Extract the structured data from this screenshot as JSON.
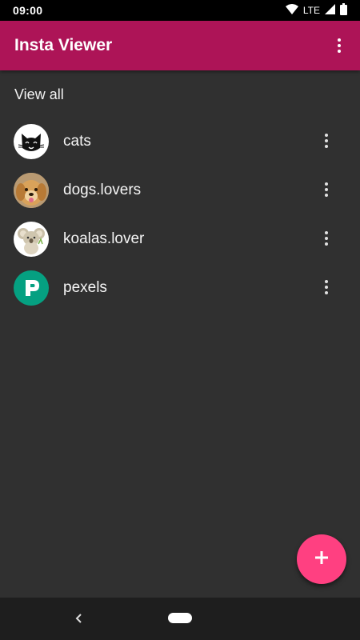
{
  "status_bar": {
    "time": "09:00",
    "network_label": "LTE",
    "icons": [
      "wifi-icon",
      "cell-signal-icon",
      "battery-icon"
    ]
  },
  "app_bar": {
    "title": "Insta Viewer",
    "background_color": "#ad1457",
    "menu_icon": "more-vert-icon"
  },
  "main": {
    "view_all_label": "View all",
    "items": [
      {
        "label": "cats",
        "avatar": "cat-avatar"
      },
      {
        "label": "dogs.lovers",
        "avatar": "dog-avatar"
      },
      {
        "label": "koalas.lover",
        "avatar": "koala-avatar"
      },
      {
        "label": "pexels",
        "avatar": "pexels-avatar"
      }
    ]
  },
  "fab": {
    "icon": "plus-icon",
    "color": "#ff4081"
  },
  "nav_bar": {
    "back_icon": "back-chevron-icon",
    "home_icon": "home-pill-icon"
  }
}
